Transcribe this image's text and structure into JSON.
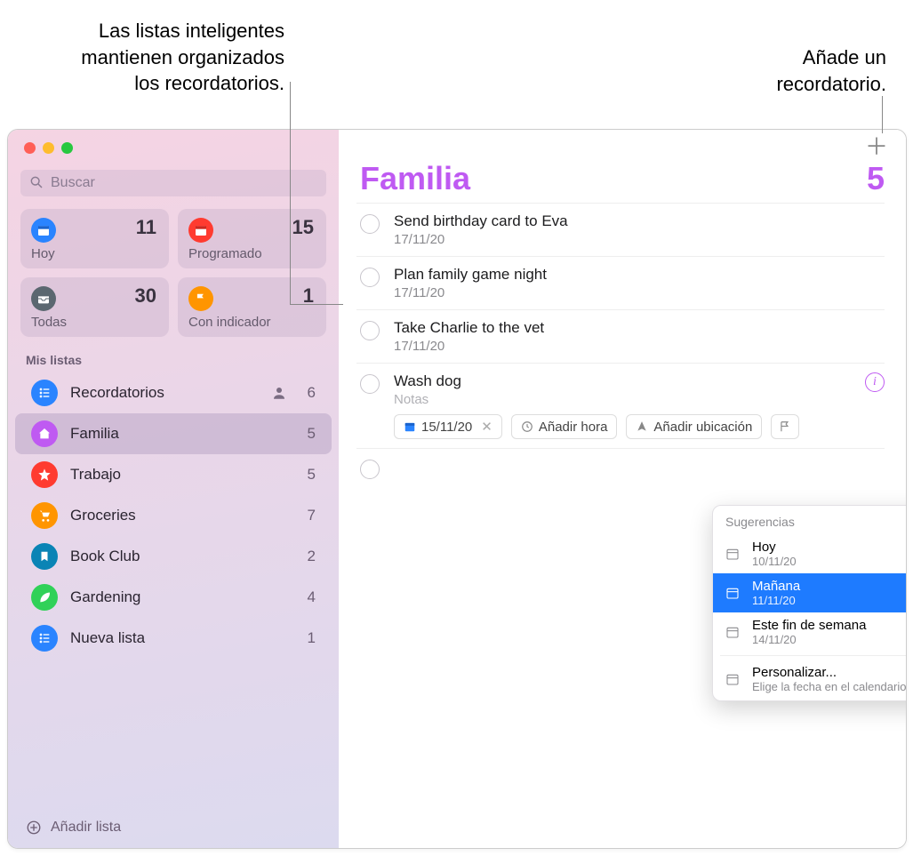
{
  "callouts": {
    "smart_lists": "Las listas inteligentes mantienen organizados los recordatorios.",
    "add_reminder": "Añade un recordatorio."
  },
  "search": {
    "placeholder": "Buscar"
  },
  "smart": {
    "today": {
      "label": "Hoy",
      "count": "11"
    },
    "scheduled": {
      "label": "Programado",
      "count": "15"
    },
    "all": {
      "label": "Todas",
      "count": "30"
    },
    "flagged": {
      "label": "Con indicador",
      "count": "1"
    }
  },
  "sections": {
    "my_lists": "Mis listas"
  },
  "lists": [
    {
      "name": "Recordatorios",
      "count": "6",
      "shared": true
    },
    {
      "name": "Familia",
      "count": "5"
    },
    {
      "name": "Trabajo",
      "count": "5"
    },
    {
      "name": "Groceries",
      "count": "7"
    },
    {
      "name": "Book Club",
      "count": "2"
    },
    {
      "name": "Gardening",
      "count": "4"
    },
    {
      "name": "Nueva lista",
      "count": "1"
    }
  ],
  "add_list_label": "Añadir lista",
  "main": {
    "title": "Familia",
    "count": "5",
    "reminders": [
      {
        "title": "Send birthday card to Eva",
        "date": "17/11/20"
      },
      {
        "title": "Plan family game night",
        "date": "17/11/20"
      },
      {
        "title": "Take Charlie to the vet",
        "date": "17/11/20"
      }
    ],
    "editing": {
      "title": "Wash dog",
      "notes_placeholder": "Notas",
      "date_chip": "15/11/20",
      "time_chip": "Añadir hora",
      "location_chip": "Añadir ubicación"
    }
  },
  "popover": {
    "header": "Sugerencias",
    "items": [
      {
        "title": "Hoy",
        "sub": "10/11/20"
      },
      {
        "title": "Mañana",
        "sub": "11/11/20"
      },
      {
        "title": "Este fin de semana",
        "sub": "14/11/20"
      }
    ],
    "custom": {
      "title": "Personalizar...",
      "sub": "Elige la fecha en el calendario"
    }
  }
}
